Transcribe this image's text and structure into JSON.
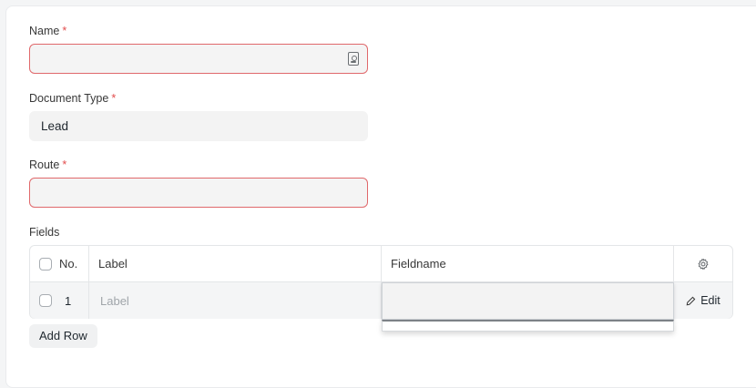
{
  "form": {
    "name": {
      "label": "Name",
      "required_mark": "*",
      "value": "",
      "icon": "contact-icon"
    },
    "document_type": {
      "label": "Document Type",
      "required_mark": "*",
      "value": "Lead"
    },
    "route": {
      "label": "Route",
      "required_mark": "*",
      "value": ""
    }
  },
  "fields_table": {
    "title": "Fields",
    "headers": {
      "no": "No.",
      "label": "Label",
      "fieldname": "Fieldname"
    },
    "rows": [
      {
        "no": "1",
        "label_placeholder": "Label",
        "fieldname": "",
        "edit_label": "Edit"
      }
    ],
    "settings_icon": "gear-icon",
    "add_row_label": "Add Row"
  },
  "colors": {
    "error_border": "#e0686b",
    "required": "#e24c4c",
    "input_bg": "#f3f3f3"
  }
}
